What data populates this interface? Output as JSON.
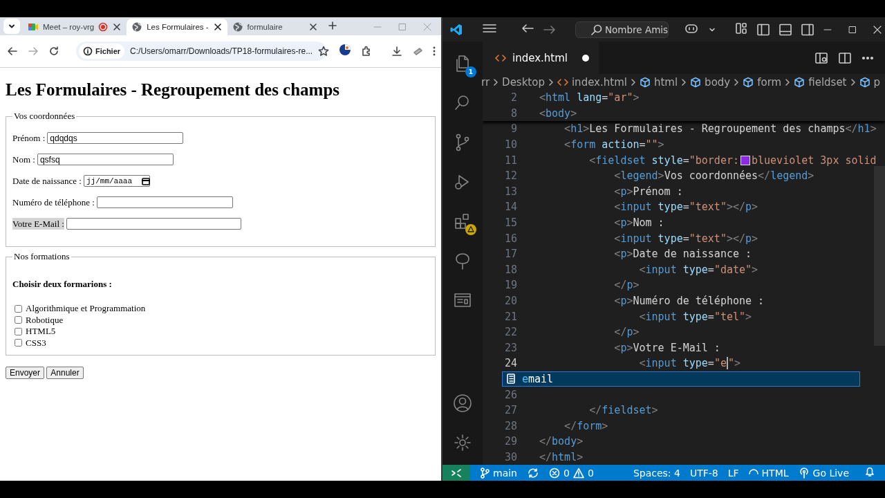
{
  "browser": {
    "tabs": [
      {
        "label": "Meet – roy-vrg",
        "selected": false,
        "kind": "meet",
        "recording": true
      },
      {
        "label": "Les Formulaires -",
        "selected": true,
        "kind": "page",
        "recording": false
      },
      {
        "label": "formulaire",
        "selected": false,
        "kind": "page",
        "recording": false
      }
    ],
    "address": {
      "badge": "Fichier",
      "url": "C:/Users/omarr/Downloads/TP18-formulaires-re..."
    }
  },
  "page": {
    "title": "Les Formulaires - Regroupement des champs",
    "fieldsets": [
      {
        "legend": "Vos coordonnées",
        "fields": [
          {
            "label": "Prénom :",
            "kind": "text",
            "value": "qdqdqs",
            "highlighted": false
          },
          {
            "label": "Nom :",
            "kind": "text",
            "value": "qsfsq",
            "highlighted": false
          },
          {
            "label": "Date de naissance :",
            "kind": "date",
            "placeholder": "jj/mm/aaaa",
            "highlighted": false
          },
          {
            "label": "Numéro de téléphone :",
            "kind": "text",
            "highlighted": false
          },
          {
            "label": "Votre E-Mail :",
            "kind": "wide",
            "highlighted": true
          }
        ]
      },
      {
        "legend": "Nos formations",
        "prompt": "Choisir deux formarions :",
        "options": [
          {
            "label": "Algorithmique et Programmation",
            "checked": false
          },
          {
            "label": "Robotique",
            "checked": false
          },
          {
            "label": "HTML5",
            "checked": false
          },
          {
            "label": "CSS3",
            "checked": false
          }
        ]
      }
    ],
    "buttons": [
      "Envoyer",
      "Annuler"
    ]
  },
  "editor": {
    "search": "Nombre Amis",
    "explorer_badge": "1",
    "tab": {
      "label": "index.html",
      "modified": true
    },
    "breadcrumbs": [
      {
        "label": "rr",
        "kind": "folder"
      },
      {
        "label": "Desktop",
        "kind": "folder"
      },
      {
        "label": "index.html",
        "kind": "file"
      },
      {
        "label": "html",
        "kind": "element"
      },
      {
        "label": "body",
        "kind": "element"
      },
      {
        "label": "form",
        "kind": "element"
      },
      {
        "label": "fieldset",
        "kind": "element"
      },
      {
        "label": "p",
        "kind": "element"
      }
    ],
    "sticky": [
      {
        "number": "2",
        "tokens": [
          {
            "kind": "p",
            "text": "<"
          },
          {
            "kind": "t",
            "text": "html"
          },
          {
            "kind": "a",
            "text": " lang"
          },
          {
            "kind": "x",
            "text": "="
          },
          {
            "kind": "s",
            "text": "\"ar\""
          },
          {
            "kind": "p",
            "text": ">"
          }
        ]
      },
      {
        "number": "8",
        "tokens": [
          {
            "kind": "p",
            "text": "<"
          },
          {
            "kind": "t",
            "text": "body"
          },
          {
            "kind": "p",
            "text": ">"
          }
        ]
      }
    ],
    "lines": [
      {
        "kind": "code",
        "number": "9",
        "current": false,
        "tokens": [
          {
            "kind": "p",
            "text": "    <"
          },
          {
            "kind": "t",
            "text": "h1"
          },
          {
            "kind": "p",
            "text": ">"
          },
          {
            "kind": "x",
            "text": "Les Formulaires - Regroupement des champs"
          },
          {
            "kind": "p",
            "text": "</"
          },
          {
            "kind": "t",
            "text": "h1"
          },
          {
            "kind": "p",
            "text": ">"
          }
        ]
      },
      {
        "kind": "code",
        "number": "10",
        "current": false,
        "tokens": [
          {
            "kind": "p",
            "text": "    <"
          },
          {
            "kind": "t",
            "text": "form"
          },
          {
            "kind": "a",
            "text": " action"
          },
          {
            "kind": "x",
            "text": "="
          },
          {
            "kind": "s",
            "text": "\"\""
          },
          {
            "kind": "p",
            "text": ">"
          }
        ]
      },
      {
        "kind": "code",
        "number": "11",
        "current": false,
        "tokens": [
          {
            "kind": "p",
            "text": "        <"
          },
          {
            "kind": "t",
            "text": "fieldset"
          },
          {
            "kind": "a",
            "text": " style"
          },
          {
            "kind": "x",
            "text": "="
          },
          {
            "kind": "s",
            "text": "\"border:"
          },
          {
            "kind": "swatch",
            "color": "#8a2be2"
          },
          {
            "kind": "s",
            "text": "blueviolet 3px solid"
          }
        ]
      },
      {
        "kind": "code",
        "number": "12",
        "current": false,
        "tokens": [
          {
            "kind": "p",
            "text": "            <"
          },
          {
            "kind": "t",
            "text": "legend"
          },
          {
            "kind": "p",
            "text": ">"
          },
          {
            "kind": "x",
            "text": "Vos coordonnées"
          },
          {
            "kind": "p",
            "text": "</"
          },
          {
            "kind": "t",
            "text": "legend"
          },
          {
            "kind": "p",
            "text": ">"
          }
        ]
      },
      {
        "kind": "code",
        "number": "13",
        "current": false,
        "tokens": [
          {
            "kind": "p",
            "text": "            <"
          },
          {
            "kind": "t",
            "text": "p"
          },
          {
            "kind": "p",
            "text": ">"
          },
          {
            "kind": "x",
            "text": "Prénom :"
          }
        ]
      },
      {
        "kind": "code",
        "number": "14",
        "current": false,
        "tokens": [
          {
            "kind": "p",
            "text": "            <"
          },
          {
            "kind": "t",
            "text": "input"
          },
          {
            "kind": "a",
            "text": " type"
          },
          {
            "kind": "x",
            "text": "="
          },
          {
            "kind": "s",
            "text": "\"text\""
          },
          {
            "kind": "p",
            "text": "></"
          },
          {
            "kind": "t",
            "text": "p"
          },
          {
            "kind": "p",
            "text": ">"
          }
        ]
      },
      {
        "kind": "code",
        "number": "15",
        "current": false,
        "tokens": [
          {
            "kind": "p",
            "text": "            <"
          },
          {
            "kind": "t",
            "text": "p"
          },
          {
            "kind": "p",
            "text": ">"
          },
          {
            "kind": "x",
            "text": "Nom :"
          }
        ]
      },
      {
        "kind": "code",
        "number": "16",
        "current": false,
        "tokens": [
          {
            "kind": "p",
            "text": "            <"
          },
          {
            "kind": "t",
            "text": "input"
          },
          {
            "kind": "a",
            "text": " type"
          },
          {
            "kind": "x",
            "text": "="
          },
          {
            "kind": "s",
            "text": "\"text\""
          },
          {
            "kind": "p",
            "text": "></"
          },
          {
            "kind": "t",
            "text": "p"
          },
          {
            "kind": "p",
            "text": ">"
          }
        ]
      },
      {
        "kind": "code",
        "number": "17",
        "current": false,
        "tokens": [
          {
            "kind": "p",
            "text": "            <"
          },
          {
            "kind": "t",
            "text": "p"
          },
          {
            "kind": "p",
            "text": ">"
          },
          {
            "kind": "x",
            "text": "Date de naissance :"
          }
        ]
      },
      {
        "kind": "code",
        "number": "18",
        "current": false,
        "tokens": [
          {
            "kind": "p",
            "text": "                <"
          },
          {
            "kind": "t",
            "text": "input"
          },
          {
            "kind": "a",
            "text": " type"
          },
          {
            "kind": "x",
            "text": "="
          },
          {
            "kind": "s",
            "text": "\"date\""
          },
          {
            "kind": "p",
            "text": ">"
          }
        ]
      },
      {
        "kind": "code",
        "number": "19",
        "current": false,
        "tokens": [
          {
            "kind": "p",
            "text": "            </"
          },
          {
            "kind": "t",
            "text": "p"
          },
          {
            "kind": "p",
            "text": ">"
          }
        ]
      },
      {
        "kind": "code",
        "number": "20",
        "current": false,
        "tokens": [
          {
            "kind": "p",
            "text": "            <"
          },
          {
            "kind": "t",
            "text": "p"
          },
          {
            "kind": "p",
            "text": ">"
          },
          {
            "kind": "x",
            "text": "Numéro de téléphone :"
          }
        ]
      },
      {
        "kind": "code",
        "number": "21",
        "current": false,
        "tokens": [
          {
            "kind": "p",
            "text": "                <"
          },
          {
            "kind": "t",
            "text": "input"
          },
          {
            "kind": "a",
            "text": " type"
          },
          {
            "kind": "x",
            "text": "="
          },
          {
            "kind": "s",
            "text": "\"tel\""
          },
          {
            "kind": "p",
            "text": ">"
          }
        ]
      },
      {
        "kind": "code",
        "number": "22",
        "current": false,
        "tokens": [
          {
            "kind": "p",
            "text": "            </"
          },
          {
            "kind": "t",
            "text": "p"
          },
          {
            "kind": "p",
            "text": ">"
          }
        ]
      },
      {
        "kind": "code",
        "number": "23",
        "current": false,
        "tokens": [
          {
            "kind": "p",
            "text": "            <"
          },
          {
            "kind": "t",
            "text": "p"
          },
          {
            "kind": "p",
            "text": ">"
          },
          {
            "kind": "x",
            "text": "Votre E-Mail :"
          }
        ]
      },
      {
        "kind": "code",
        "number": "24",
        "current": true,
        "tokens": [
          {
            "kind": "p",
            "text": "                <"
          },
          {
            "kind": "t",
            "text": "input"
          },
          {
            "kind": "a",
            "text": " type"
          },
          {
            "kind": "x",
            "text": "="
          },
          {
            "kind": "s",
            "text": "\"e"
          },
          {
            "kind": "cursor"
          },
          {
            "kind": "s",
            "text": "\""
          },
          {
            "kind": "p",
            "text": ">"
          }
        ]
      },
      {
        "kind": "suggestion",
        "match": "e",
        "rest": "mail"
      },
      {
        "kind": "code",
        "number": "26",
        "current": false
      },
      {
        "kind": "code",
        "number": "27",
        "current": false,
        "tokens": [
          {
            "kind": "p",
            "text": "        </"
          },
          {
            "kind": "t",
            "text": "fieldset"
          },
          {
            "kind": "p",
            "text": ">"
          }
        ]
      },
      {
        "kind": "code",
        "number": "28",
        "current": false,
        "tokens": [
          {
            "kind": "p",
            "text": "    </"
          },
          {
            "kind": "t",
            "text": "form"
          },
          {
            "kind": "p",
            "text": ">"
          }
        ]
      },
      {
        "kind": "code",
        "number": "29",
        "current": false,
        "tokens": [
          {
            "kind": "p",
            "text": "</"
          },
          {
            "kind": "t",
            "text": "body"
          },
          {
            "kind": "p",
            "text": ">"
          }
        ]
      },
      {
        "kind": "code",
        "number": "30",
        "current": false,
        "tokens": [
          {
            "kind": "p",
            "text": "</"
          },
          {
            "kind": "t",
            "text": "html"
          },
          {
            "kind": "p",
            "text": ">"
          }
        ]
      }
    ],
    "status": {
      "branch": "main",
      "errors": "0",
      "warnings": "0",
      "indent": "Spaces: 4",
      "encoding": "UTF-8",
      "eol": "LF",
      "language": "HTML",
      "live": "Go Live"
    }
  }
}
